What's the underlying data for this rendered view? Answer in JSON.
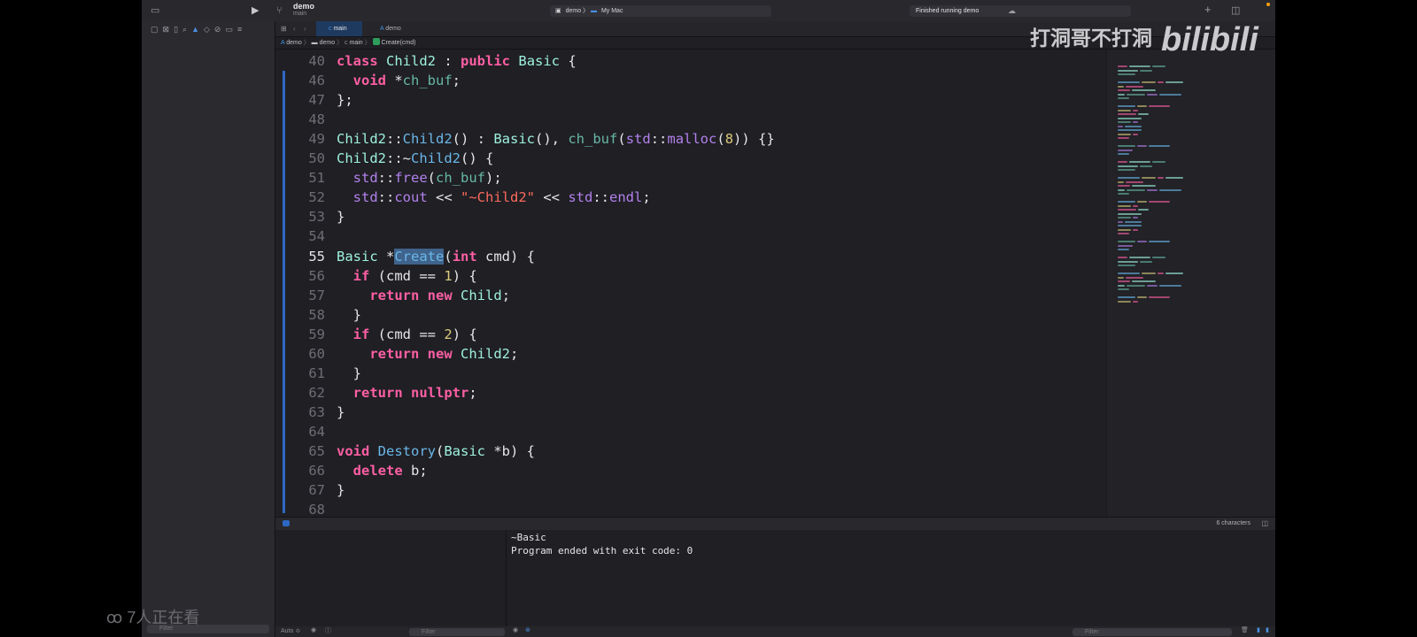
{
  "toolbar": {
    "project_name": "demo",
    "branch": "main",
    "scheme_target": "demo",
    "run_destination": "My Mac",
    "status": "Finished running demo"
  },
  "tabs": [
    {
      "label": "main",
      "active": true
    },
    {
      "label": "demo",
      "active": false
    }
  ],
  "breadcrumb": [
    "demo",
    "demo",
    "main",
    "Create(cmd)"
  ],
  "editor": {
    "lines": [
      {
        "num": "40",
        "code": "class Child2 : public Basic {"
      },
      {
        "num": "46",
        "code": "  void *ch_buf;"
      },
      {
        "num": "47",
        "code": "};"
      },
      {
        "num": "48",
        "code": ""
      },
      {
        "num": "49",
        "code": "Child2::Child2() : Basic(), ch_buf(std::malloc(8)) {}"
      },
      {
        "num": "50",
        "code": "Child2::~Child2() {"
      },
      {
        "num": "51",
        "code": "  std::free(ch_buf);"
      },
      {
        "num": "52",
        "code": "  std::cout << \"~Child2\" << std::endl;"
      },
      {
        "num": "53",
        "code": "}"
      },
      {
        "num": "54",
        "code": ""
      },
      {
        "num": "55",
        "code": "Basic *Create(int cmd) {"
      },
      {
        "num": "56",
        "code": "  if (cmd == 1) {"
      },
      {
        "num": "57",
        "code": "    return new Child;"
      },
      {
        "num": "58",
        "code": "  }"
      },
      {
        "num": "59",
        "code": "  if (cmd == 2) {"
      },
      {
        "num": "60",
        "code": "    return new Child2;"
      },
      {
        "num": "61",
        "code": "  }"
      },
      {
        "num": "62",
        "code": "  return nullptr;"
      },
      {
        "num": "63",
        "code": "}"
      },
      {
        "num": "64",
        "code": ""
      },
      {
        "num": "65",
        "code": "void Destory(Basic *b) {"
      },
      {
        "num": "66",
        "code": "  delete b;"
      },
      {
        "num": "67",
        "code": "}"
      },
      {
        "num": "68",
        "code": ""
      }
    ],
    "current_line": "55",
    "selected_text": "Create"
  },
  "debug": {
    "selection_count": "6 characters",
    "scope": "Auto ≎"
  },
  "console": {
    "output": [
      "~Basic",
      "Program ended with exit code: 0"
    ]
  },
  "filters": {
    "navigator_placeholder": "Filter",
    "variables_placeholder": "Filter",
    "console_placeholder": "Filter"
  },
  "overlay": {
    "watermark_text": "打洞哥不打洞",
    "watermark_logo": "bilibili",
    "viewers": "7人正在看"
  },
  "colors": {
    "keyword": "#fc5fa3",
    "type": "#9ef1dd",
    "function": "#67b7a4",
    "string": "#fc6a5d",
    "number": "#d9c97c",
    "library": "#b281eb",
    "selection": "#3f638b",
    "change_bar": "#2d68c4"
  }
}
